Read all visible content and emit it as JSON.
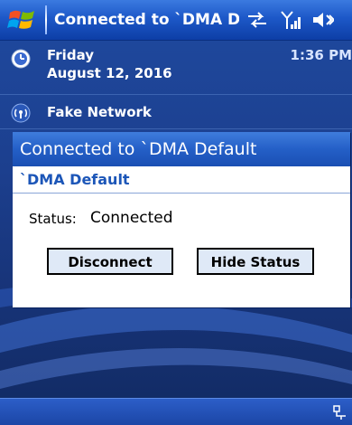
{
  "titlebar": {
    "title": "Connected to `DMA D",
    "icons": [
      "windows-start-icon",
      "connectivity-icon",
      "signal-icon",
      "volume-icon"
    ]
  },
  "today": {
    "day": "Friday",
    "date": "August 12, 2016",
    "time": "1:36 PM",
    "network": "Fake Network"
  },
  "dialog": {
    "title": "Connected to `DMA Default",
    "subtitle": "`DMA Default",
    "status_label": "Status:",
    "status_value": "Connected",
    "disconnect_label": "Disconnect",
    "hide_status_label": "Hide Status"
  },
  "colors": {
    "titlebar": "#1d58c8",
    "dialog_title": "#245fc7",
    "subtitle_text": "#1c56b8",
    "button_face": "#dfe9f7"
  }
}
